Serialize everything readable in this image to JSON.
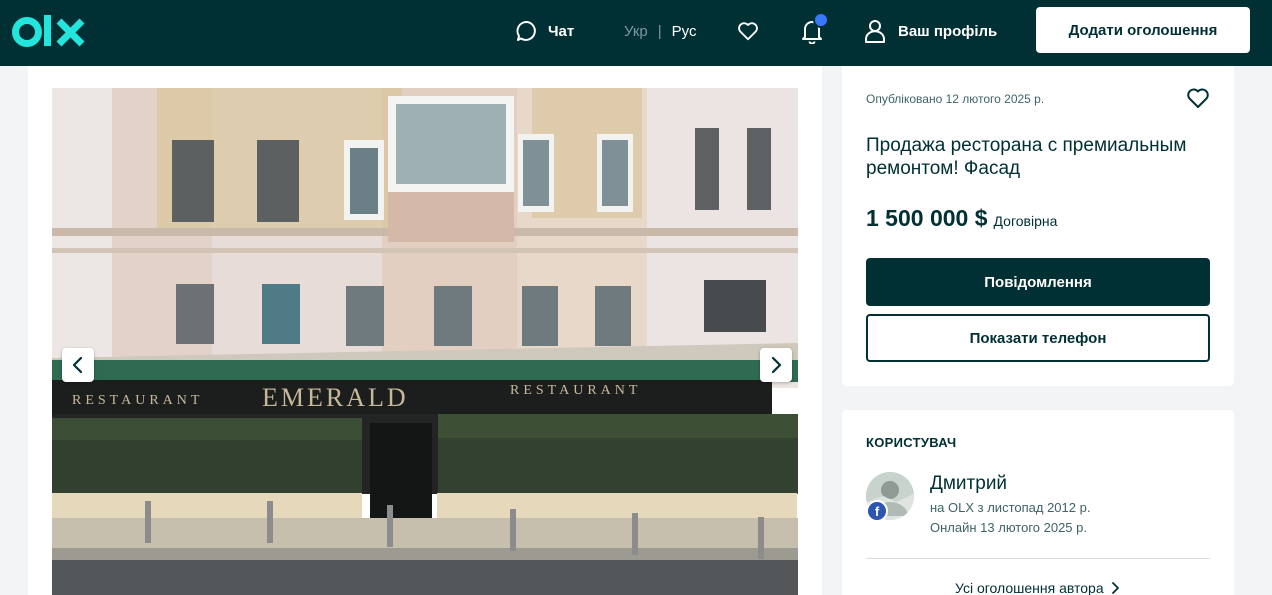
{
  "header": {
    "chat_label": "Чат",
    "lang_uk": "Укр",
    "lang_sep": "|",
    "lang_ru": "Рус",
    "profile_label": "Ваш профіль",
    "add_ad_label": "Додати оголошення",
    "colors": {
      "background": "#002f34",
      "accent": "#23e5db",
      "notification": "#3a77ff"
    }
  },
  "gallery": {
    "prev_icon": "chevron-left-icon",
    "next_icon": "chevron-right-icon",
    "sign_left": "RESTAURANT",
    "sign_center": "EMERALD",
    "sign_right": "RESTAURANT"
  },
  "ad": {
    "published": "Опубліковано 12 лютого 2025 р.",
    "title": "Продажа ресторана с премиальным ремонтом! Фасад",
    "price": "1 500 000 $",
    "negotiable": "Договірна",
    "message_label": "Повідомлення",
    "phone_label": "Показати телефон"
  },
  "user": {
    "heading": "КОРИСТУВАЧ",
    "name": "Дмитрий",
    "since": "на OLX з листопад 2012 р.",
    "online": "Онлайн 13 лютого 2025 р.",
    "badge": "f",
    "all_ads_label": "Усі оголошення автора"
  }
}
